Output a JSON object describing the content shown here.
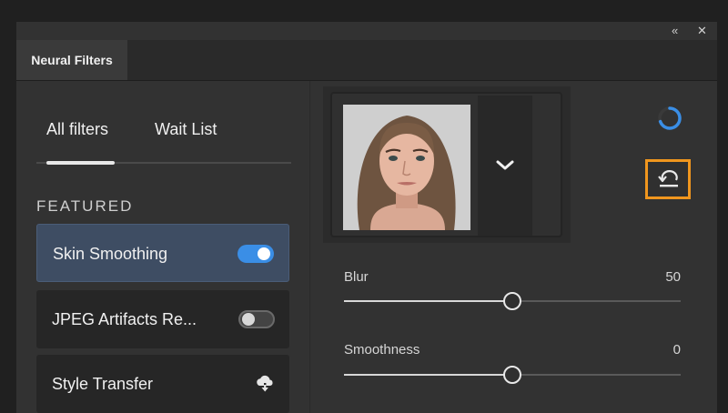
{
  "window": {
    "collapse_glyph": "«",
    "close_glyph": "✕"
  },
  "panel": {
    "tab_title": "Neural Filters"
  },
  "subtabs": {
    "all_filters": "All filters",
    "wait_list": "Wait List",
    "active": "all_filters"
  },
  "featured": {
    "section_label": "FEATURED",
    "items": [
      {
        "label": "Skin Smoothing",
        "control": "toggle",
        "enabled": true,
        "selected": true
      },
      {
        "label": "JPEG Artifacts Re...",
        "control": "toggle",
        "enabled": false,
        "selected": false
      },
      {
        "label": "Style Transfer",
        "control": "cloud-download-icon",
        "selected": false
      }
    ]
  },
  "preview": {
    "dropdown_icon": "chevron-down-icon"
  },
  "actions": {
    "status_icon": "loading-spinner-icon",
    "reset_icon": "reset-icon"
  },
  "sliders": [
    {
      "label": "Blur",
      "value": "50",
      "level": 0.5
    },
    {
      "label": "Smoothness",
      "value": "0",
      "level": 0.5
    }
  ],
  "colors": {
    "accent": "#3a8ee6",
    "highlight_outline": "#f0961e",
    "selected_item_bg": "#3e4d63"
  }
}
